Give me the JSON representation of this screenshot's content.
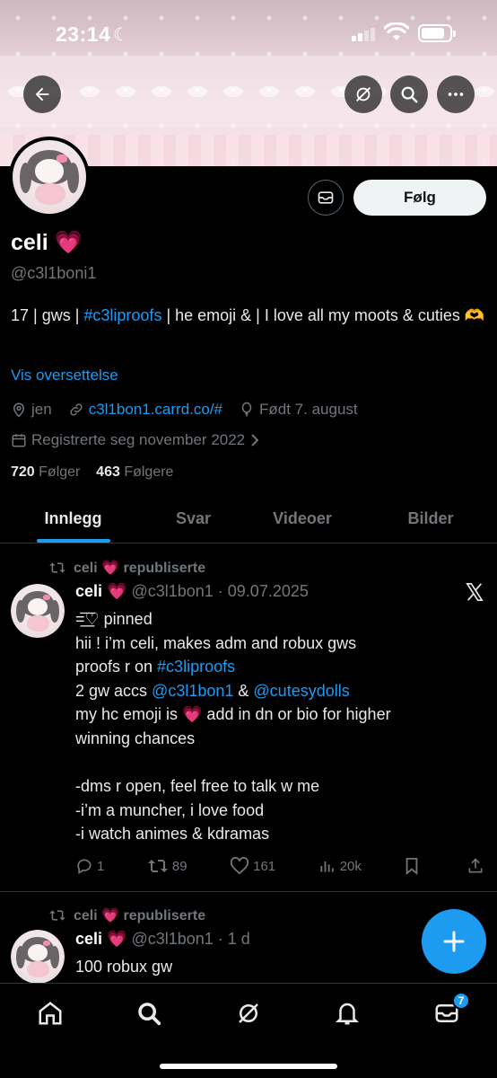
{
  "status_bar": {
    "time": "23:14",
    "moon": "☾"
  },
  "profile": {
    "name": "celi 💗",
    "handle": "@c3l1boni1",
    "bio_part1": "17 | gws | ",
    "bio_hashtag": "#c3liproofs",
    "bio_part2": " | he emoji & | I love all my moots & cuties 🫶",
    "translate": "Vis oversettelse",
    "location": "jen",
    "website": "c3l1bon1.carrd.co/#",
    "birthday": "Født 7. august",
    "joined": "Registrerte seg november 2022",
    "following_count": "720",
    "following_label": "Følger",
    "followers_count": "463",
    "followers_label": "Følgere",
    "follow_button": "Følg"
  },
  "tabs": [
    "Innlegg",
    "Svar",
    "Videoer",
    "Bilder"
  ],
  "posts": [
    {
      "repost_label": "celi 💗 republiserte",
      "name": "celi 💗",
      "meta": "@c3l1bon1 · 09.07.2025",
      "lines": [
        "=͟͟͞♡ pinned",
        "hii ! i’m celi, makes adm and robux gws",
        "proofs r on ",
        "2 gw accs ",
        "my hc emoji is 💗  add in dn or bio for higher",
        "winning chances",
        "",
        "-dms r open, feel free to talk w me",
        "-i’m a muncher, i love food",
        "-i watch animes & kdramas"
      ],
      "hashtag": "#c3liproofs",
      "mention1": "@c3l1bon1",
      "amp": " & ",
      "mention2": "@cutesydolls",
      "replies": "1",
      "reposts": "89",
      "likes": "161",
      "views": "20k"
    },
    {
      "repost_label": "celi 💗 republiserte",
      "name": "celi 💗",
      "meta": "@c3l1bon1 · 1 d",
      "text": "100 robux gw"
    }
  ],
  "bottom_nav": {
    "messages_badge": "7"
  }
}
